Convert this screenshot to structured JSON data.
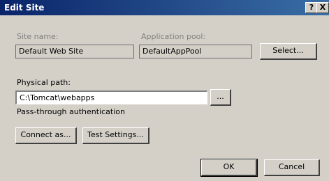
{
  "window": {
    "title": "Edit Site",
    "help_glyph": "?",
    "close_glyph": "X"
  },
  "site": {
    "label": "Site name:",
    "value": "Default Web Site"
  },
  "pool": {
    "label": "Application pool:",
    "value": "DefaultAppPool",
    "select_button": "Select..."
  },
  "physical_path": {
    "label": "Physical path:",
    "value": "C:\\Tomcat\\webapps",
    "browse_button": "..."
  },
  "auth": {
    "label": "Pass-through authentication"
  },
  "buttons": {
    "connect_as": "Connect as...",
    "test_settings": "Test Settings...",
    "ok": "OK",
    "cancel": "Cancel"
  }
}
